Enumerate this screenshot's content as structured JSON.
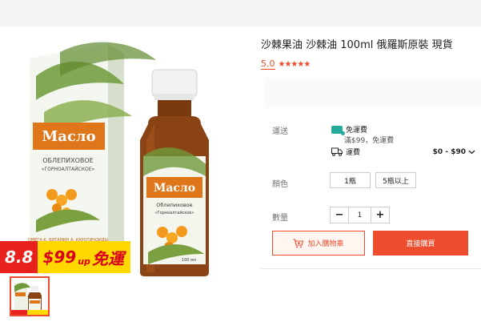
{
  "product": {
    "title": "沙棘果油 沙棘油 100ml 俄羅斯原裝 現貨",
    "rating_score": "5.0",
    "stars": "★★★★★"
  },
  "promo": {
    "date": "8.8",
    "offer_amount": "$99",
    "offer_suffix": "up",
    "offer_text": "免運"
  },
  "product_image": {
    "box_brand": "Масло",
    "box_name": "ОБЛЕПИХОВОЕ",
    "box_sub": "«ГОРНОАЛТАЙСКОЕ»",
    "box_note": "ОМЕГА-6, ВИТАМИН А, КАРОТИНОИДЫ",
    "bottle_brand": "Масло",
    "bottle_name": "Облепиховое",
    "bottle_sub": "«Горноалтайское»",
    "bottle_volume": "100 мл"
  },
  "shipping": {
    "label": "運送",
    "free_label": "免運費",
    "free_condition": "滿$99，免運費",
    "fee_label": "運費",
    "fee_range": "$0 - $90"
  },
  "variant": {
    "label": "顏色",
    "options": [
      "1瓶",
      "5瓶以上"
    ]
  },
  "quantity": {
    "label": "數量",
    "value": "1",
    "minus": "−",
    "plus": "+"
  },
  "actions": {
    "add_to_cart": "加入購物車",
    "buy_now": "直接購買"
  },
  "colors": {
    "accent": "#ee4d2d",
    "free_ship": "#26aa99",
    "promo_red": "#e8211d",
    "promo_yellow": "#ffd800"
  }
}
